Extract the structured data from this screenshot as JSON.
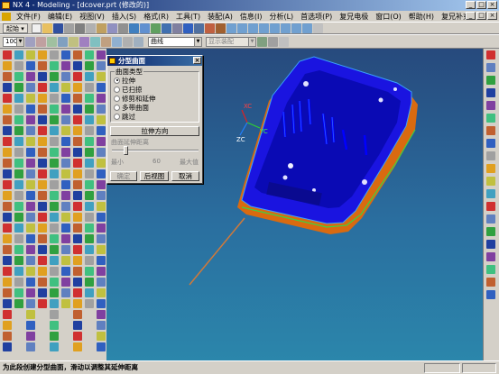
{
  "window": {
    "title": "NX 4 - Modeling - [dcover.prt (修改的)]",
    "controls": [
      "_",
      "□",
      "×"
    ]
  },
  "menubar": {
    "items": [
      "文件(F)",
      "编辑(E)",
      "视图(V)",
      "插入(S)",
      "格式(R)",
      "工具(T)",
      "装配(A)",
      "信息(I)",
      "分析(L)",
      "首选项(P)",
      "复兄电极",
      "窗口(O)",
      "帮助(H)",
      "复兄补充"
    ],
    "mdi_controls": [
      "_",
      "□",
      "×"
    ]
  },
  "toolbar1": {
    "start_label": "起始 ▾"
  },
  "toolbar2": {
    "zoom_value": "100",
    "filter_value": "曲线",
    "display_value": "显示装配"
  },
  "dialog": {
    "title": "分型曲面",
    "close": "×",
    "group_label": "曲面类型",
    "options": [
      {
        "label": "拉伸",
        "checked": true
      },
      {
        "label": "已扫掠",
        "checked": false
      },
      {
        "label": "修剪和延伸",
        "checked": false
      },
      {
        "label": "多带曲面",
        "checked": false
      },
      {
        "label": "跳过",
        "checked": false
      }
    ],
    "direction_button": "拉伸方向",
    "distance_label": "曲面延伸距离",
    "min_label": "最小",
    "mid_value": "60",
    "max_label": "最大值",
    "ok_button": "确定",
    "back_button": "后视图",
    "cancel_button": "取消"
  },
  "axes": {
    "x_label": "XC",
    "y_label": "YC",
    "z_label": "ZC"
  },
  "status": {
    "message": "为此段创建分型曲面，滑动以调整其延伸距离"
  },
  "colors": {
    "viewport_top": "#274a7d",
    "viewport_bottom": "#2b86ab",
    "part_blue": "#0a14e6",
    "part_orange": "#d96a10",
    "edge_green": "#40d040",
    "titlebar": "#0a246a"
  }
}
